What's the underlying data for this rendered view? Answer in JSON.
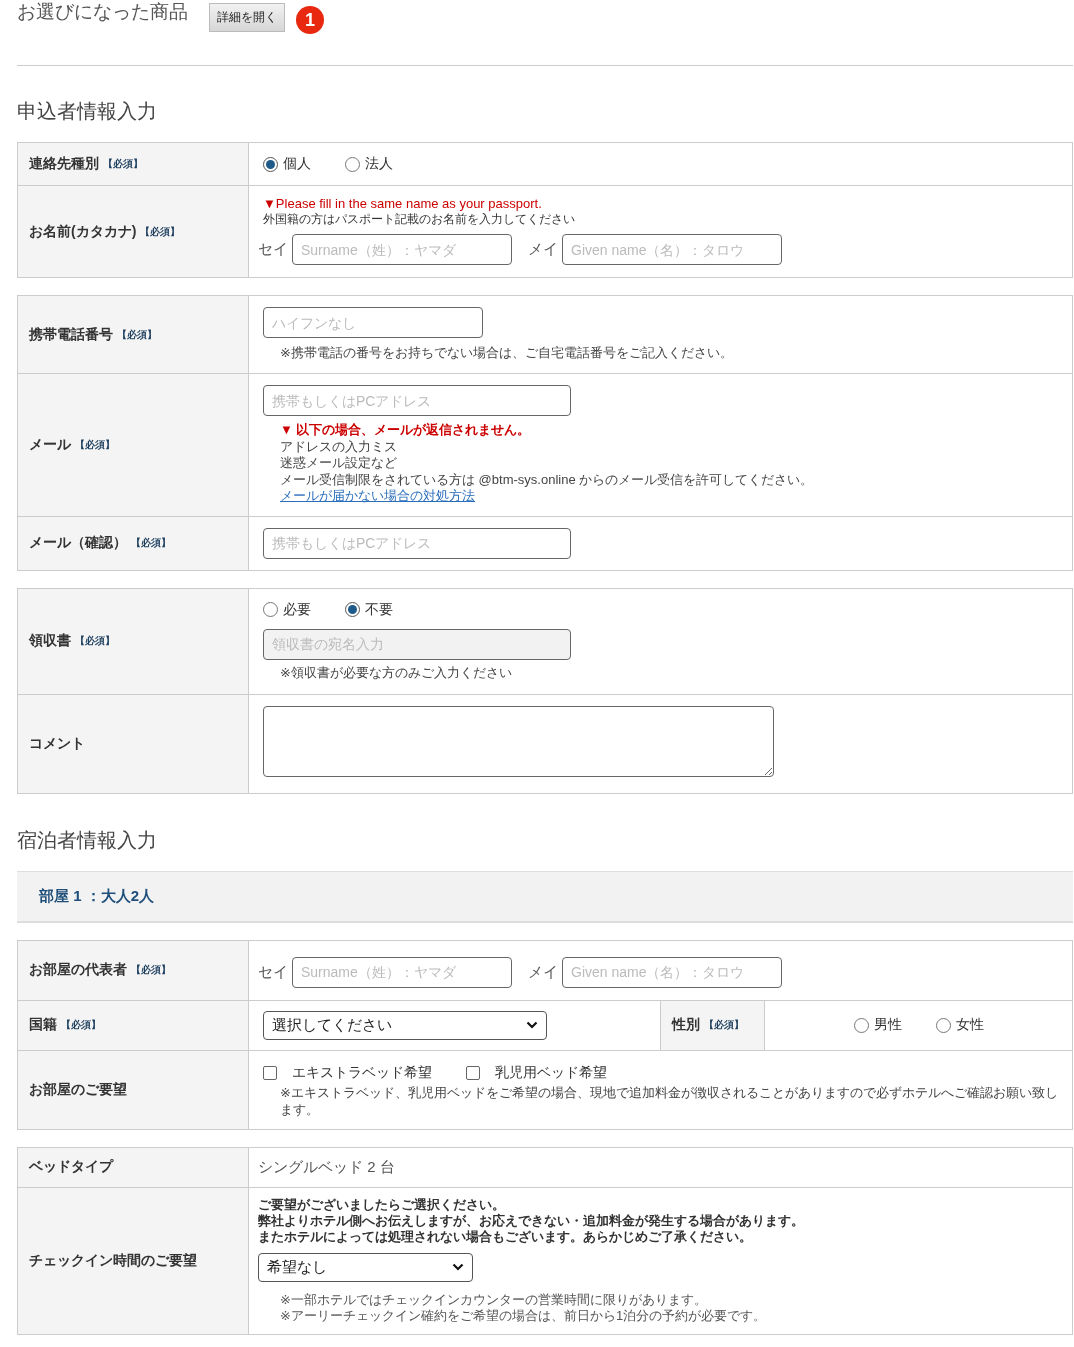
{
  "selected_product": {
    "title": "お選びになった商品",
    "button": "詳細を開く",
    "badge": "1"
  },
  "applicant": {
    "heading": "申込者情報入力",
    "tables": [
      [
        {
          "kind": "radio",
          "label": "連絡先種別",
          "required": "【必須】",
          "options": [
            {
              "label": "個人",
              "selected": true
            },
            {
              "label": "法人",
              "selected": false
            }
          ]
        },
        {
          "kind": "name",
          "label": "お名前(カタカナ)",
          "required": "【必須】",
          "warning": "▼Please fill in the same name as your passport.",
          "note": "外国籍の方はパスポート記載のお名前を入力してください",
          "fields": [
            {
              "prefix": "セイ",
              "placeholder": "Surname（姓）：ヤマダ"
            },
            {
              "prefix": "メイ",
              "placeholder": "Given name（名）：タロウ"
            }
          ]
        }
      ],
      [
        {
          "kind": "input",
          "label": "携帯電話番号",
          "required": "【必須】",
          "placeholder": "ハイフンなし",
          "note": "※携帯電話の番号をお持ちでない場合は、ご自宅電話番号をご記入ください。"
        },
        {
          "kind": "email",
          "label": "メール",
          "required": "【必須】",
          "placeholder": "携帯もしくはPCアドレス",
          "warning": "▼ 以下の場合、メールが返信されません。",
          "lines": [
            "アドレスの入力ミス",
            "迷惑メール設定など",
            "メール受信制限をされている方は @btm-sys.online からのメール受信を許可してください。"
          ],
          "link": "メールが届かない場合の対処方法"
        },
        {
          "kind": "input",
          "label": "メール（確認）",
          "required": "【必須】",
          "placeholder": "携帯もしくはPCアドレス"
        }
      ],
      [
        {
          "kind": "receipt",
          "label": "領収書",
          "required": "【必須】",
          "options": [
            {
              "label": "必要",
              "selected": false
            },
            {
              "label": "不要",
              "selected": true
            }
          ],
          "placeholder": "領収書の宛名入力",
          "disabled": true,
          "note": "※領収書が必要な方のみご入力ください"
        },
        {
          "kind": "textarea",
          "label": "コメント"
        }
      ]
    ]
  },
  "guest": {
    "heading": "宿泊者情報入力",
    "room": "部屋 1 ：大人2人",
    "tables": [
      [
        {
          "kind": "name",
          "label": "お部屋の代表者",
          "required": "【必須】",
          "fields": [
            {
              "prefix": "セイ",
              "placeholder": "Surname（姓）：ヤマダ"
            },
            {
              "prefix": "メイ",
              "placeholder": "Given name（名）：タロウ"
            }
          ]
        },
        {
          "kind": "split",
          "label": "国籍",
          "required": "【必須】",
          "select": "選択してください",
          "side_label": "性別",
          "side_required": "【必須】",
          "options": [
            {
              "label": "男性",
              "selected": false
            },
            {
              "label": "女性",
              "selected": false
            }
          ]
        },
        {
          "kind": "checkbox",
          "label": "お部屋のご要望",
          "options": [
            {
              "label": "エキストラベッド希望",
              "checked": false
            },
            {
              "label": "乳児用ベッド希望",
              "checked": false
            }
          ],
          "note": "※エキストラベッド、乳児用ベッドをご希望の場合、現地で追加料金が徴収されることがありますので必ずホテルへご確認お願い致します。"
        }
      ],
      [
        {
          "kind": "text",
          "label": "ベッドタイプ",
          "value": "シングルベッド 2 台"
        },
        {
          "kind": "checkin",
          "label": "チェックイン時間のご要望",
          "intro": [
            "ご要望がございましたらご選択ください。",
            "弊社よりホテル側へお伝えしますが、お応えできない・追加料金が発生する場合があります。",
            "またホテルによっては処理されない場合もございます。あらかじめご了承ください。"
          ],
          "select": "希望なし",
          "notes": [
            "※一部ホテルではチェックインカウンターの営業時間に限りがあります。",
            "※アーリーチェックイン確約をご希望の場合は、前日から1泊分の予約が必要です。"
          ]
        }
      ]
    ]
  }
}
